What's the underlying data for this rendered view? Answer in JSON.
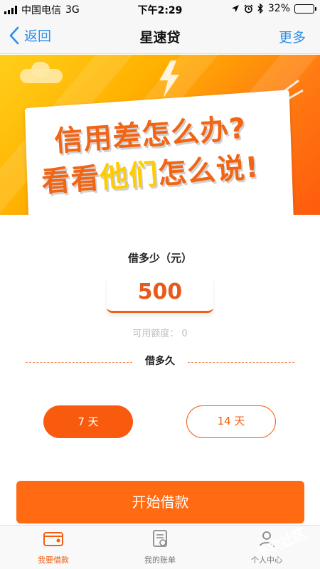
{
  "status": {
    "carrier": "中国电信",
    "network": "3G",
    "time": "下午2:29",
    "battery": "32%",
    "battery_level": 0.32
  },
  "nav": {
    "back_label": "返回",
    "title": "星速贷",
    "more_label": "更多"
  },
  "banner": {
    "line1": "信用差怎么办?",
    "line2_a": "看看",
    "line2_b": "他们",
    "line2_c": "怎么说!"
  },
  "loan": {
    "amount_label": "借多少（元）",
    "amount_value": "500",
    "credit_label": "可用额度：",
    "credit_value": "0",
    "period_label": "借多久",
    "options": [
      {
        "label": "7 天",
        "selected": true
      },
      {
        "label": "14 天",
        "selected": false
      }
    ],
    "submit_label": "开始借款"
  },
  "tabs": [
    {
      "label": "我要借款",
      "icon": "wallet-icon",
      "active": true
    },
    {
      "label": "我的账单",
      "icon": "bill-icon",
      "active": false
    },
    {
      "label": "个人中心",
      "icon": "user-icon",
      "active": false
    }
  ],
  "watermark": {
    "text": "卡农社区"
  },
  "colors": {
    "accent": "#f85a0e",
    "link": "#2f8ee8",
    "muted": "#bdbdbd"
  }
}
